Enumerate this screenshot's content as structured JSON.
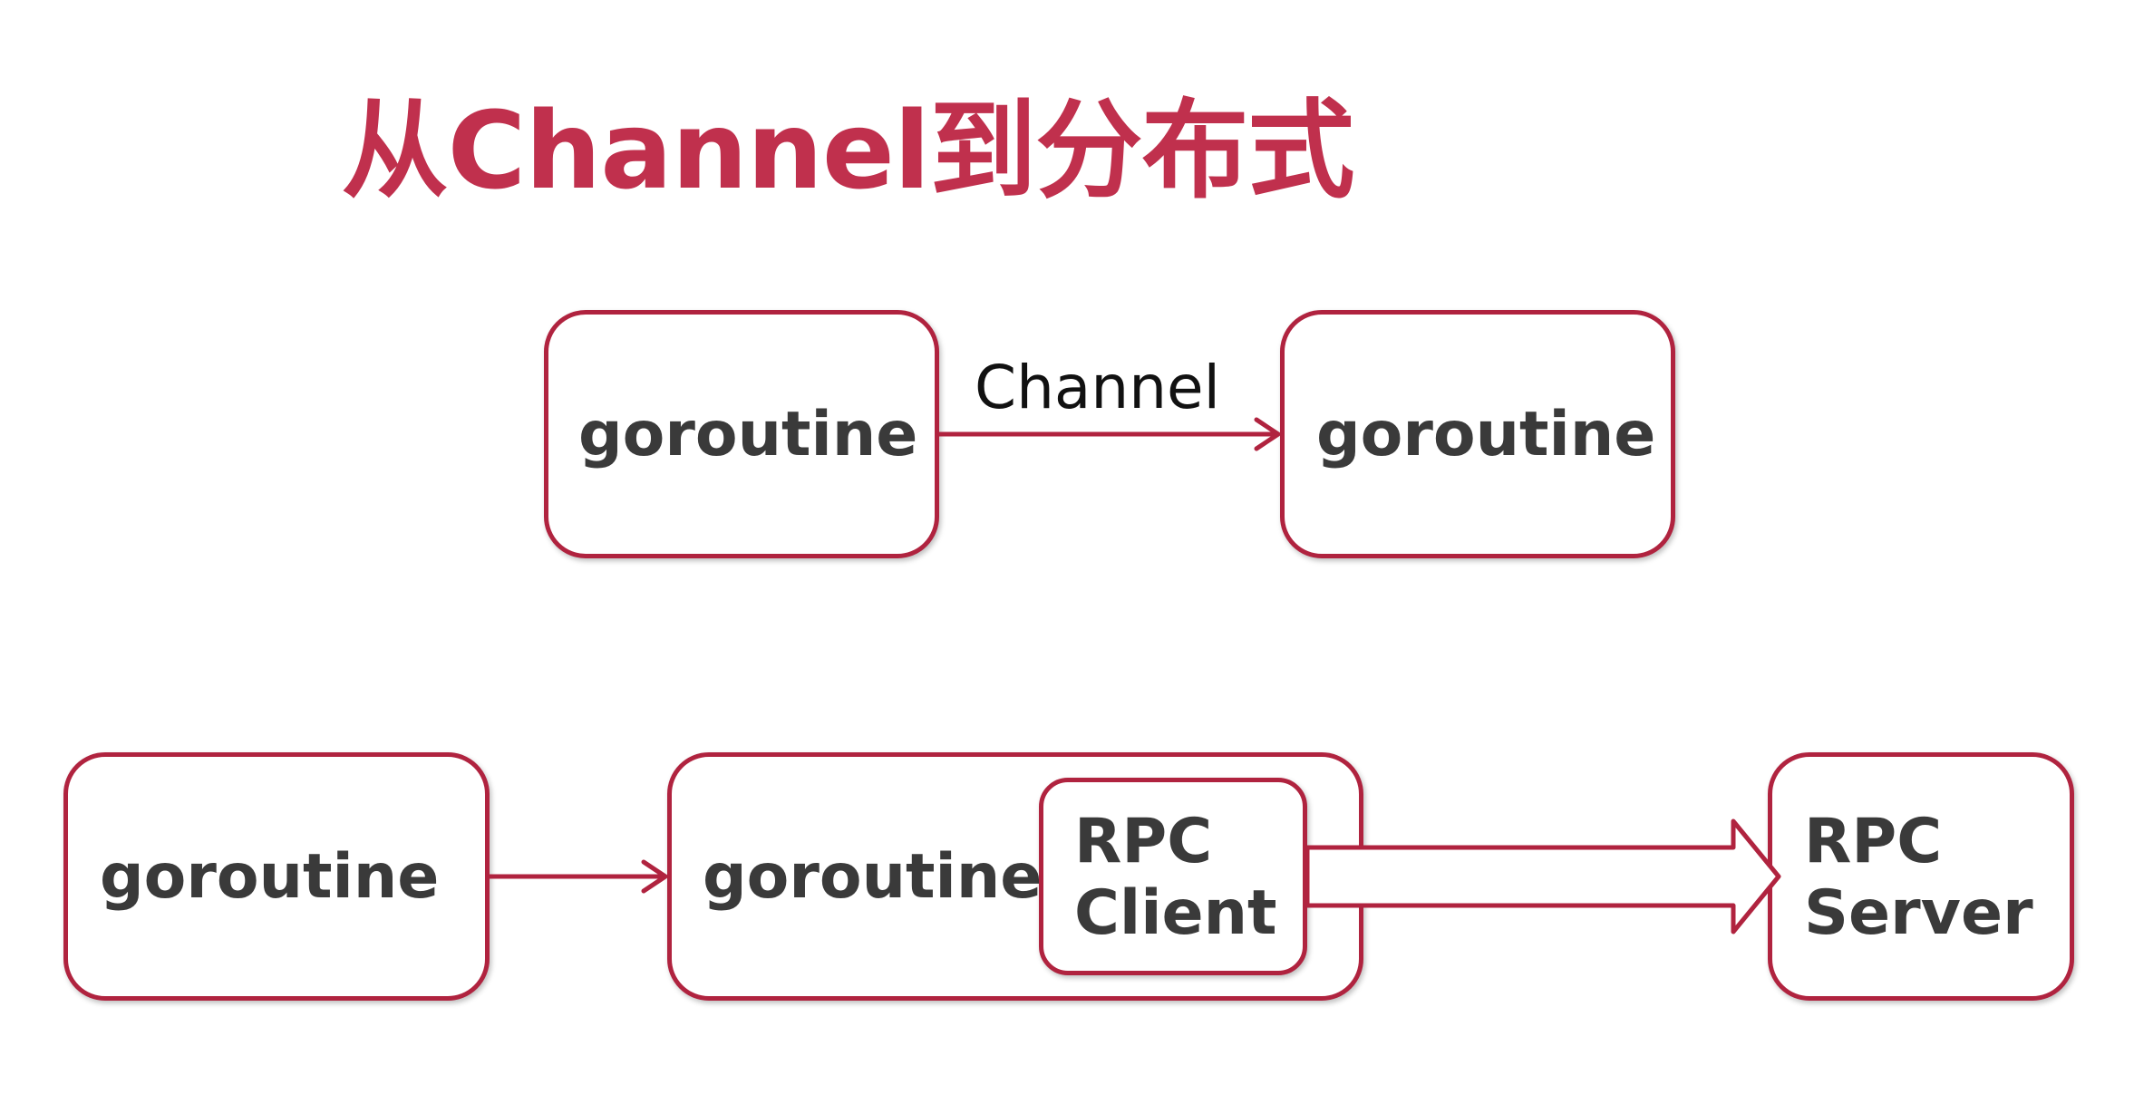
{
  "title": "从Channel到分布式",
  "colors": {
    "accent": "#c0304d",
    "border": "#b0233f",
    "text": "#3a3a3a"
  },
  "top_row": {
    "left_node": "goroutine",
    "edge_label": "Channel",
    "right_node": "goroutine"
  },
  "bottom_row": {
    "left_node": "goroutine",
    "middle_node": "goroutine",
    "client_lines": [
      "RPC",
      "Client"
    ],
    "server_lines": [
      "RPC",
      "Server"
    ]
  }
}
